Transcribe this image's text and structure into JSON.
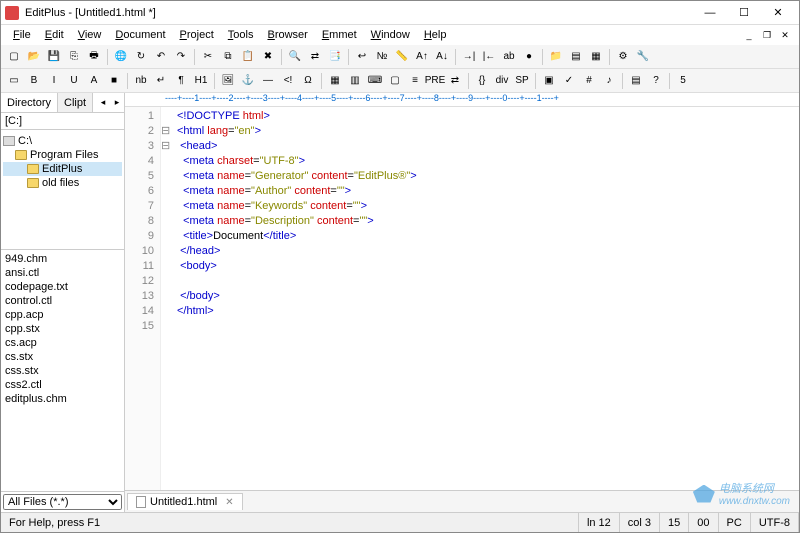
{
  "app": {
    "title": "EditPlus - [Untitled1.html *]"
  },
  "win": {
    "min": "—",
    "max": "☐",
    "close": "✕"
  },
  "menu": [
    "File",
    "Edit",
    "View",
    "Document",
    "Project",
    "Tools",
    "Browser",
    "Emmet",
    "Window",
    "Help"
  ],
  "mdi": {
    "min": "_",
    "restore": "❐",
    "close": "✕"
  },
  "toolbar1": [
    {
      "n": "new-icon",
      "g": "▢"
    },
    {
      "n": "open-icon",
      "g": "📂"
    },
    {
      "n": "save-icon",
      "g": "💾"
    },
    {
      "n": "save-all-icon",
      "g": "⎘"
    },
    {
      "n": "print-icon",
      "g": "🖶"
    },
    {
      "n": "sep"
    },
    {
      "n": "browser-icon",
      "g": "🌐"
    },
    {
      "n": "refresh-icon",
      "g": "↻"
    },
    {
      "n": "undo-icon",
      "g": "↶"
    },
    {
      "n": "redo-icon",
      "g": "↷"
    },
    {
      "n": "sep"
    },
    {
      "n": "cut-icon",
      "g": "✂"
    },
    {
      "n": "copy-icon",
      "g": "⧉"
    },
    {
      "n": "paste-icon",
      "g": "📋"
    },
    {
      "n": "delete-icon",
      "g": "✖"
    },
    {
      "n": "sep"
    },
    {
      "n": "find-icon",
      "g": "🔍"
    },
    {
      "n": "replace-icon",
      "g": "⇄"
    },
    {
      "n": "find-files-icon",
      "g": "📑"
    },
    {
      "n": "sep"
    },
    {
      "n": "wrap-icon",
      "g": "↩"
    },
    {
      "n": "linenum-icon",
      "g": "№"
    },
    {
      "n": "ruler-icon",
      "g": "📏"
    },
    {
      "n": "font-inc-icon",
      "g": "A↑"
    },
    {
      "n": "font-dec-icon",
      "g": "A↓"
    },
    {
      "n": "sep"
    },
    {
      "n": "indent-icon",
      "g": "→|"
    },
    {
      "n": "outdent-icon",
      "g": "|←"
    },
    {
      "n": "spell-icon",
      "g": "ab"
    },
    {
      "n": "record-icon",
      "g": "●"
    },
    {
      "n": "sep"
    },
    {
      "n": "dir-icon",
      "g": "📁"
    },
    {
      "n": "output-icon",
      "g": "▤"
    },
    {
      "n": "cliptext-icon",
      "g": "▦"
    },
    {
      "n": "sep"
    },
    {
      "n": "settings-icon",
      "g": "⚙"
    },
    {
      "n": "tools-icon",
      "g": "🔧"
    }
  ],
  "toolbar2": [
    {
      "n": "select-icon",
      "g": "▭"
    },
    {
      "n": "bold-icon",
      "g": "B"
    },
    {
      "n": "italic-icon",
      "g": "I"
    },
    {
      "n": "underline-icon",
      "g": "U"
    },
    {
      "n": "font-icon",
      "g": "A"
    },
    {
      "n": "color-icon",
      "g": "■"
    },
    {
      "n": "sep"
    },
    {
      "n": "nbsp-icon",
      "g": "nb"
    },
    {
      "n": "break-icon",
      "g": "↵"
    },
    {
      "n": "para-icon",
      "g": "¶"
    },
    {
      "n": "heading-icon",
      "g": "H1"
    },
    {
      "n": "sep"
    },
    {
      "n": "image-icon",
      "g": "🖼"
    },
    {
      "n": "anchor-icon",
      "g": "⚓"
    },
    {
      "n": "hr-icon",
      "g": "—"
    },
    {
      "n": "comment-icon",
      "g": "<!"
    },
    {
      "n": "char-icon",
      "g": "Ω"
    },
    {
      "n": "sep"
    },
    {
      "n": "table-icon",
      "g": "▦"
    },
    {
      "n": "form-icon",
      "g": "▥"
    },
    {
      "n": "input-icon",
      "g": "⌨"
    },
    {
      "n": "textarea-icon",
      "g": "▢"
    },
    {
      "n": "list-icon",
      "g": "≡"
    },
    {
      "n": "pre-icon",
      "g": "PRE"
    },
    {
      "n": "marquee-icon",
      "g": "⇄"
    },
    {
      "n": "sep"
    },
    {
      "n": "script-icon",
      "g": "{}"
    },
    {
      "n": "div-icon",
      "g": "div"
    },
    {
      "n": "span-icon",
      "g": "SP"
    },
    {
      "n": "sep"
    },
    {
      "n": "obj-icon",
      "g": "▣"
    },
    {
      "n": "check-icon",
      "g": "✓"
    },
    {
      "n": "css-icon",
      "g": "#"
    },
    {
      "n": "note-icon",
      "g": "♪"
    },
    {
      "n": "sep"
    },
    {
      "n": "template-icon",
      "g": "▤"
    },
    {
      "n": "help-icon",
      "g": "?"
    },
    {
      "n": "sep"
    },
    {
      "n": "html5-icon",
      "g": "5"
    }
  ],
  "sidebar": {
    "tabs": [
      "Directory",
      "Clipt"
    ],
    "drive": "[C:]",
    "tree": [
      {
        "label": "C:\\",
        "icon": "drive",
        "indent": 0
      },
      {
        "label": "Program Files",
        "icon": "folder",
        "indent": 1
      },
      {
        "label": "EditPlus",
        "icon": "folder",
        "indent": 2,
        "sel": true
      },
      {
        "label": "old files",
        "icon": "folder",
        "indent": 2
      }
    ],
    "files": [
      "949.chm",
      "ansi.ctl",
      "codepage.txt",
      "control.ctl",
      "cpp.acp",
      "cpp.stx",
      "cs.acp",
      "cs.stx",
      "css.stx",
      "css2.ctl",
      "editplus.chm"
    ],
    "filter": "All Files (*.*)"
  },
  "code": {
    "lines": [
      {
        "n": 1,
        "f": "",
        "h": "<span class='t-tag'>&lt;!DOCTYPE</span> <span class='t-attr'>html</span><span class='t-tag'>&gt;</span>"
      },
      {
        "n": 2,
        "f": "⊟",
        "h": "<span class='t-tag'>&lt;html</span> <span class='t-attr'>lang</span>=<span class='t-val'>\"en\"</span><span class='t-tag'>&gt;</span>"
      },
      {
        "n": 3,
        "f": "⊟",
        "h": " <span class='t-tag'>&lt;head&gt;</span>"
      },
      {
        "n": 4,
        "f": "",
        "h": "  <span class='t-tag'>&lt;meta</span> <span class='t-attr'>charset</span>=<span class='t-val'>\"UTF-8\"</span><span class='t-tag'>&gt;</span>"
      },
      {
        "n": 5,
        "f": "",
        "h": "  <span class='t-tag'>&lt;meta</span> <span class='t-attr'>name</span>=<span class='t-val'>\"Generator\"</span> <span class='t-attr'>content</span>=<span class='t-val'>\"EditPlus®\"</span><span class='t-tag'>&gt;</span>"
      },
      {
        "n": 6,
        "f": "",
        "h": "  <span class='t-tag'>&lt;meta</span> <span class='t-attr'>name</span>=<span class='t-val'>\"Author\"</span> <span class='t-attr'>content</span>=<span class='t-val'>\"\"</span><span class='t-tag'>&gt;</span>"
      },
      {
        "n": 7,
        "f": "",
        "h": "  <span class='t-tag'>&lt;meta</span> <span class='t-attr'>name</span>=<span class='t-val'>\"Keywords\"</span> <span class='t-attr'>content</span>=<span class='t-val'>\"\"</span><span class='t-tag'>&gt;</span>"
      },
      {
        "n": 8,
        "f": "",
        "h": "  <span class='t-tag'>&lt;meta</span> <span class='t-attr'>name</span>=<span class='t-val'>\"Description\"</span> <span class='t-attr'>content</span>=<span class='t-val'>\"\"</span><span class='t-tag'>&gt;</span>"
      },
      {
        "n": 9,
        "f": "",
        "h": "  <span class='t-tag'>&lt;title&gt;</span>Document<span class='t-tag'>&lt;/title&gt;</span>"
      },
      {
        "n": 10,
        "f": "",
        "h": " <span class='t-tag'>&lt;/head&gt;</span>"
      },
      {
        "n": 11,
        "f": "",
        "h": " <span class='t-tag'>&lt;body&gt;</span>"
      },
      {
        "n": 12,
        "f": "",
        "h": ""
      },
      {
        "n": 13,
        "f": "",
        "h": " <span class='t-tag'>&lt;/body&gt;</span>"
      },
      {
        "n": 14,
        "f": "",
        "h": "<span class='t-tag'>&lt;/html&gt;</span>"
      },
      {
        "n": 15,
        "f": "",
        "h": ""
      }
    ]
  },
  "filetab": {
    "name": "Untitled1.html"
  },
  "status": {
    "help": "For Help, press F1",
    "ln": "ln 12",
    "col": "col 3",
    "sel": "15",
    "zero": "00",
    "mode": "PC",
    "enc": "UTF-8"
  },
  "watermark": {
    "text": "电脑系统网",
    "url": "www.dnxtw.com"
  }
}
